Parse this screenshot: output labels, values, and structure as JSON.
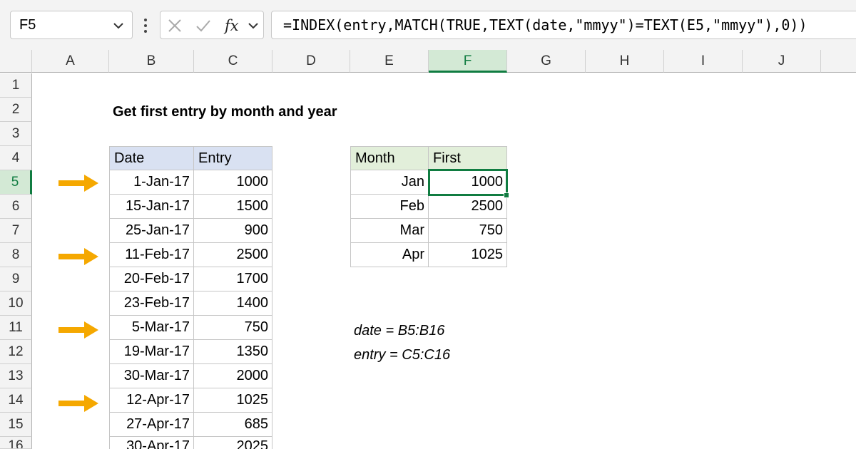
{
  "namebox": {
    "value": "F5"
  },
  "formula_bar": {
    "formula": "=INDEX(entry,MATCH(TRUE,TEXT(date,\"mmyy\")=TEXT(E5,\"mmyy\"),0))"
  },
  "columns": [
    "A",
    "B",
    "C",
    "D",
    "E",
    "F",
    "G",
    "H",
    "I",
    "J"
  ],
  "selected_column": "F",
  "rows": [
    "1",
    "2",
    "3",
    "4",
    "5",
    "6",
    "7",
    "8",
    "9",
    "10",
    "11",
    "12",
    "13",
    "14",
    "15",
    "16"
  ],
  "selected_row": "5",
  "title": "Get first entry by month and year",
  "data_table": {
    "headers": [
      "Date",
      "Entry"
    ],
    "rows": [
      [
        "1-Jan-17",
        "1000"
      ],
      [
        "15-Jan-17",
        "1500"
      ],
      [
        "25-Jan-17",
        "900"
      ],
      [
        "11-Feb-17",
        "2500"
      ],
      [
        "20-Feb-17",
        "1700"
      ],
      [
        "23-Feb-17",
        "1400"
      ],
      [
        "5-Mar-17",
        "750"
      ],
      [
        "19-Mar-17",
        "1350"
      ],
      [
        "30-Mar-17",
        "2000"
      ],
      [
        "12-Apr-17",
        "1025"
      ],
      [
        "27-Apr-17",
        "685"
      ],
      [
        "30-Apr-17",
        "2025"
      ]
    ]
  },
  "result_table": {
    "headers": [
      "Month",
      "First"
    ],
    "rows": [
      [
        "Jan",
        "1000"
      ],
      [
        "Feb",
        "2500"
      ],
      [
        "Mar",
        "750"
      ],
      [
        "Apr",
        "1025"
      ]
    ]
  },
  "named_ranges": [
    "date = B5:B16",
    "entry = C5:C16"
  ],
  "colors": {
    "arrow": "#f5a800",
    "selection": "#107c41",
    "header_blue": "#d9e1f2",
    "header_green": "#e2efda"
  }
}
